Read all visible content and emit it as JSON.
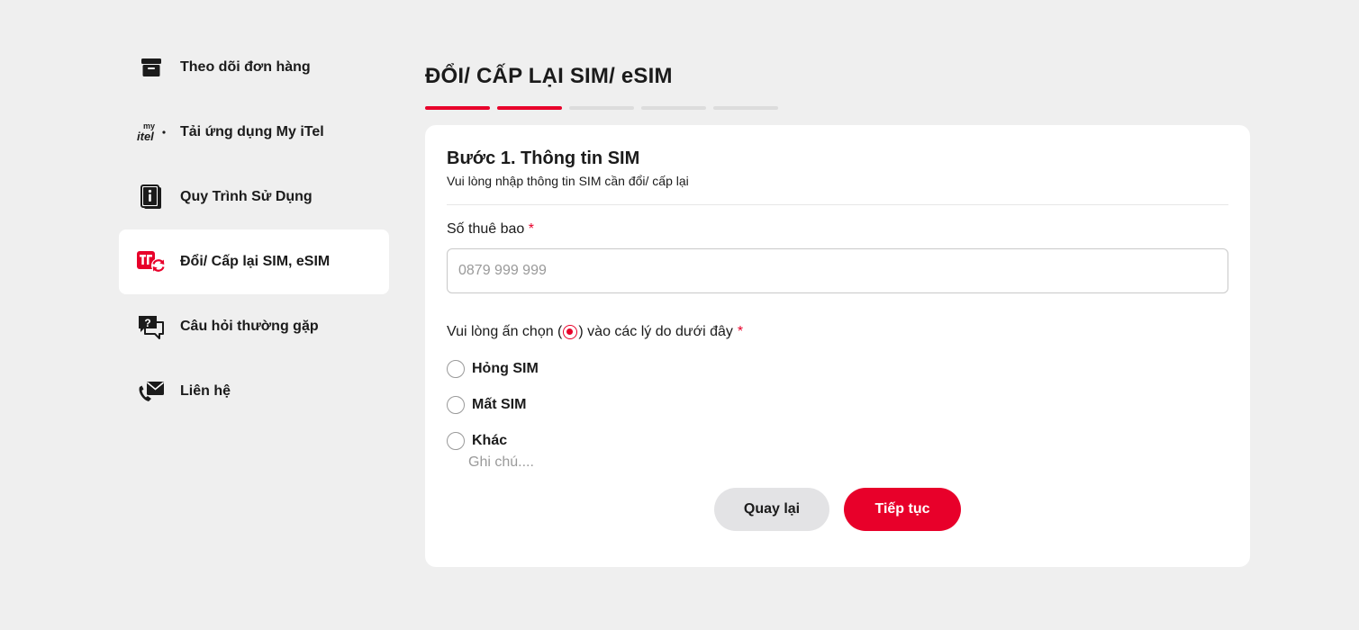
{
  "sidebar": {
    "items": [
      {
        "label": "Theo dõi đơn hàng",
        "icon": "package-box-icon",
        "active": false
      },
      {
        "label": "Tải ứng dụng My iTel",
        "icon": "my-itel-logo-icon",
        "active": false
      },
      {
        "label": "Quy Trình Sử Dụng",
        "icon": "info-book-icon",
        "active": false
      },
      {
        "label": "Đổi/ Cấp lại SIM, eSIM",
        "icon": "sim-swap-icon",
        "active": true
      },
      {
        "label": "Câu hỏi thường gặp",
        "icon": "faq-chat-icon",
        "active": false
      },
      {
        "label": "Liên hệ",
        "icon": "contact-phone-mail-icon",
        "active": false
      }
    ],
    "logo_text": {
      "my": "my",
      "itel": "itel"
    }
  },
  "page": {
    "title": "ĐỔI/ CẤP LẠI SIM/ eSIM",
    "steps_total": 5,
    "steps_completed": 2
  },
  "form": {
    "step_title": "Bước 1. Thông tin SIM",
    "step_subtitle": "Vui lòng nhập thông tin SIM cần đổi/ cấp lại",
    "phone_label": "Số thuê bao",
    "required_mark": "*",
    "phone_placeholder": "0879 999 999",
    "phone_value": "",
    "reason_prefix": "Vui lòng ấn chọn (",
    "reason_suffix": ") vào các lý do dưới đây",
    "options": [
      {
        "label": "Hỏng SIM",
        "selected": false
      },
      {
        "label": "Mất SIM",
        "selected": false
      },
      {
        "label": "Khác",
        "selected": false
      }
    ],
    "note_placeholder": "Ghi chú....",
    "back_label": "Quay lại",
    "next_label": "Tiếp tục"
  },
  "colors": {
    "accent": "#e8002a",
    "background": "#efefef",
    "card": "#ffffff",
    "text": "#1b1b1b"
  }
}
